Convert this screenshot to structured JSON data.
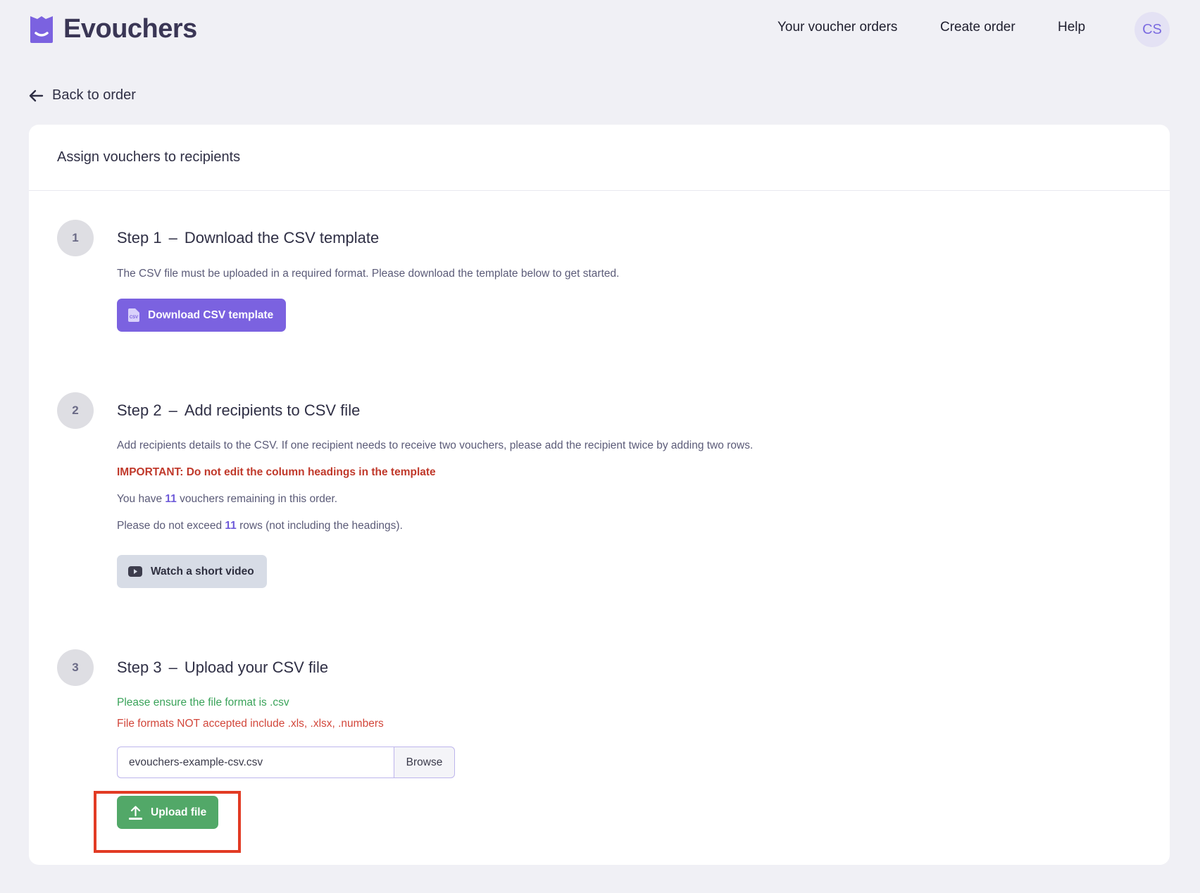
{
  "header": {
    "brand": "Evouchers",
    "nav": {
      "orders": "Your voucher orders",
      "create": "Create order",
      "help": "Help"
    },
    "avatar_initials": "CS"
  },
  "back_link": "Back to order",
  "card": {
    "title": "Assign vouchers to recipients",
    "step1": {
      "number": "1",
      "label": "Step 1",
      "dash": "–",
      "title": "Download the CSV template",
      "description": "The CSV file must be uploaded in a required format. Please download the template below to get started.",
      "button": "Download CSV template"
    },
    "step2": {
      "number": "2",
      "label": "Step 2",
      "dash": "–",
      "title": "Add recipients to CSV file",
      "description": "Add recipients details to the CSV. If one recipient needs to receive two vouchers, please add the recipient twice by adding two rows.",
      "important": "IMPORTANT: Do not edit the column headings in the template",
      "remaining_prefix": "You have",
      "remaining_count": "11",
      "remaining_suffix": "vouchers remaining in this order.",
      "limit_prefix": "Please do not exceed",
      "limit_count": "11",
      "limit_suffix": "rows (not including the headings).",
      "button": "Watch a short video"
    },
    "step3": {
      "number": "3",
      "label": "Step 3",
      "dash": "–",
      "title": "Upload your CSV file",
      "format_ok": "Please ensure the file format is .csv",
      "format_bad": "File formats NOT accepted include .xls, .xlsx, .numbers",
      "file_value": "evouchers-example-csv.csv",
      "browse": "Browse",
      "upload_button": "Upload file"
    }
  },
  "colors": {
    "brand": "#7b62e0",
    "upload_green": "#52a868",
    "highlight_red": "#e23b24"
  }
}
